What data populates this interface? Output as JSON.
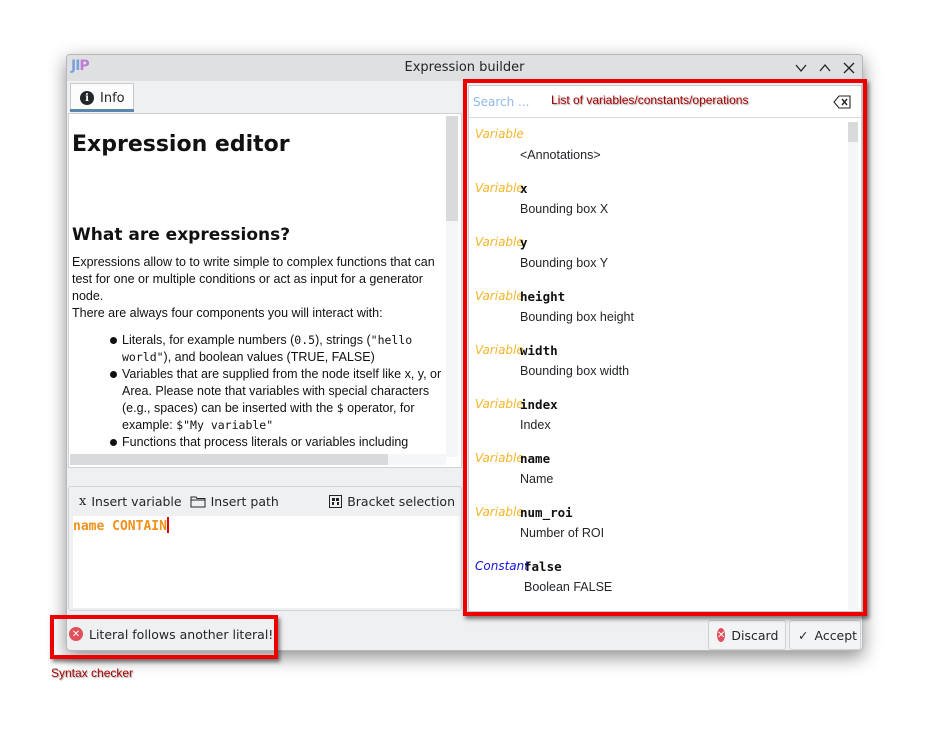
{
  "window": {
    "title": "Expression builder",
    "logo_text_1": "JI",
    "logo_text_2": "P",
    "controls": [
      "minimize",
      "maximize",
      "close"
    ]
  },
  "left": {
    "tab_label": "Info",
    "doc": {
      "h1": "Expression editor",
      "h2": "What are expressions?",
      "p1": "Expressions allow to to write simple to complex functions that can test for one or multiple conditions or act as input for a generator node.",
      "p2": "There are always four components you will interact with:",
      "bullets": [
        {
          "parts": [
            "Literals, for example numbers (",
            "0.5",
            "), strings (",
            "\"hello world\"",
            "), and boolean values (TRUE, FALSE)"
          ]
        },
        {
          "parts": [
            "Variables that are supplied from the node itself like ",
            "x",
            ", ",
            "y",
            ", or ",
            "Area",
            ". Please note that variables with special characters (e.g., spaces) can be inserted with the ",
            "$",
            " operator, for example: ",
            "$\"My variable\""
          ]
        },
        {
          "parts": [
            "Functions that process literals or variables including"
          ]
        }
      ]
    },
    "toolbar": {
      "insert_variable": "Insert variable",
      "insert_variable_glyph": "x",
      "insert_path": "Insert path",
      "bracket_selection": "Bracket selection"
    },
    "editor": {
      "value": "name CONTAIN"
    }
  },
  "right": {
    "search_placeholder": "Search ...",
    "search_value": "",
    "items": [
      {
        "kind": "Variable",
        "name": "",
        "desc": "<Annotations>"
      },
      {
        "kind": "Variable",
        "name": "x",
        "desc": "Bounding box X"
      },
      {
        "kind": "Variable",
        "name": "y",
        "desc": "Bounding box Y"
      },
      {
        "kind": "Variable",
        "name": "height",
        "desc": "Bounding box height"
      },
      {
        "kind": "Variable",
        "name": "width",
        "desc": "Bounding box width"
      },
      {
        "kind": "Variable",
        "name": "index",
        "desc": "Index"
      },
      {
        "kind": "Variable",
        "name": "name",
        "desc": "Name"
      },
      {
        "kind": "Variable",
        "name": "num_roi",
        "desc": "Number of ROI"
      },
      {
        "kind": "Constant",
        "name": "false",
        "desc": "Boolean FALSE"
      }
    ]
  },
  "status": {
    "message": "Literal follows another literal!",
    "type": "error"
  },
  "buttons": {
    "discard": "Discard",
    "accept": "Accept"
  },
  "annotations": {
    "list_label": "List of variables/constants/operations",
    "syntax_label": "Syntax checker"
  },
  "colors": {
    "variable_kind": "#f5b52a",
    "constant_kind": "#1414d8",
    "code_text": "#f0911a",
    "annotation_red": "#ee0000",
    "error_icon": "#e0505a"
  }
}
